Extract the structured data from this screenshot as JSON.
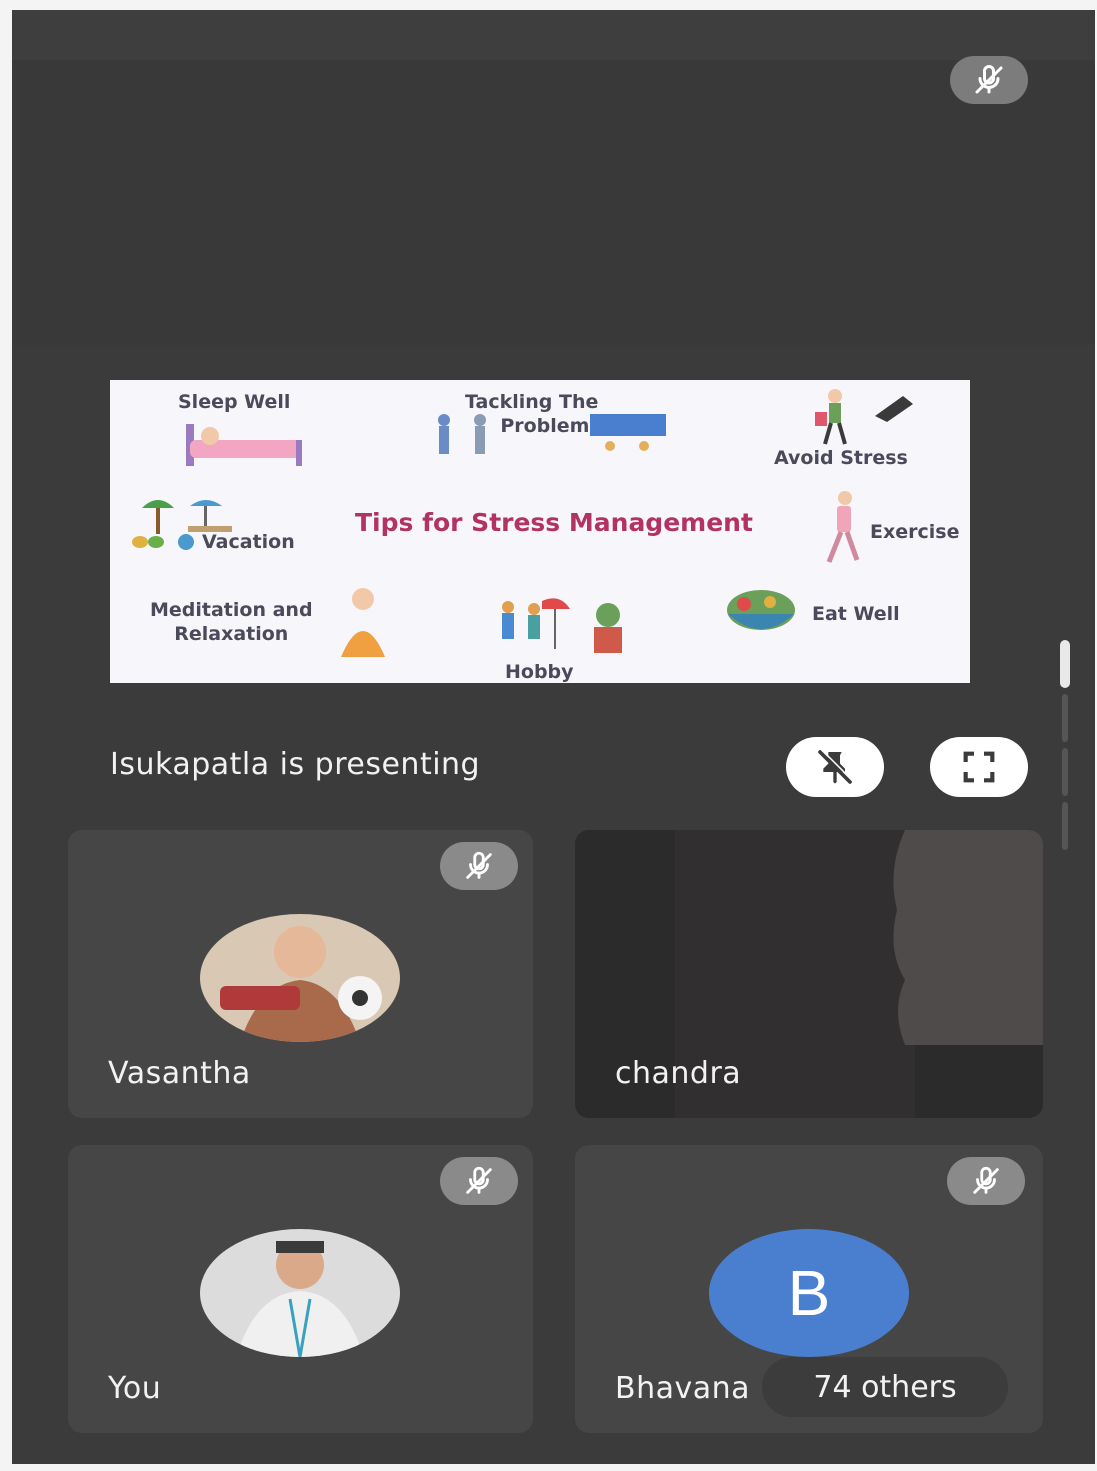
{
  "slide": {
    "title": "Tips for Stress Management",
    "items": {
      "sleep": "Sleep Well",
      "tackling": "Tackling The Problem",
      "avoid": "Avoid Stress",
      "vacation": "Vacation",
      "exercise": "Exercise",
      "meditation": "Meditation and Relaxation",
      "hobby": "Hobby",
      "eat": "Eat Well"
    }
  },
  "presenter": {
    "label": "Isukapatla is presenting"
  },
  "participants": [
    {
      "name": "Vasantha",
      "muted": true
    },
    {
      "name": "chandra",
      "muted": false
    },
    {
      "name": "You",
      "muted": true
    },
    {
      "name": "Bhavana",
      "initial": "B",
      "muted": true,
      "avatar_color": "#4a7fd0"
    }
  ],
  "others_label": "74 others",
  "colors": {
    "background": "#3b3b3b",
    "tile": "#464646",
    "slide_title": "#b2335f"
  },
  "icons": {
    "mic": "mic-off-icon",
    "pin": "unpin-icon",
    "fullscreen": "fullscreen-icon"
  }
}
